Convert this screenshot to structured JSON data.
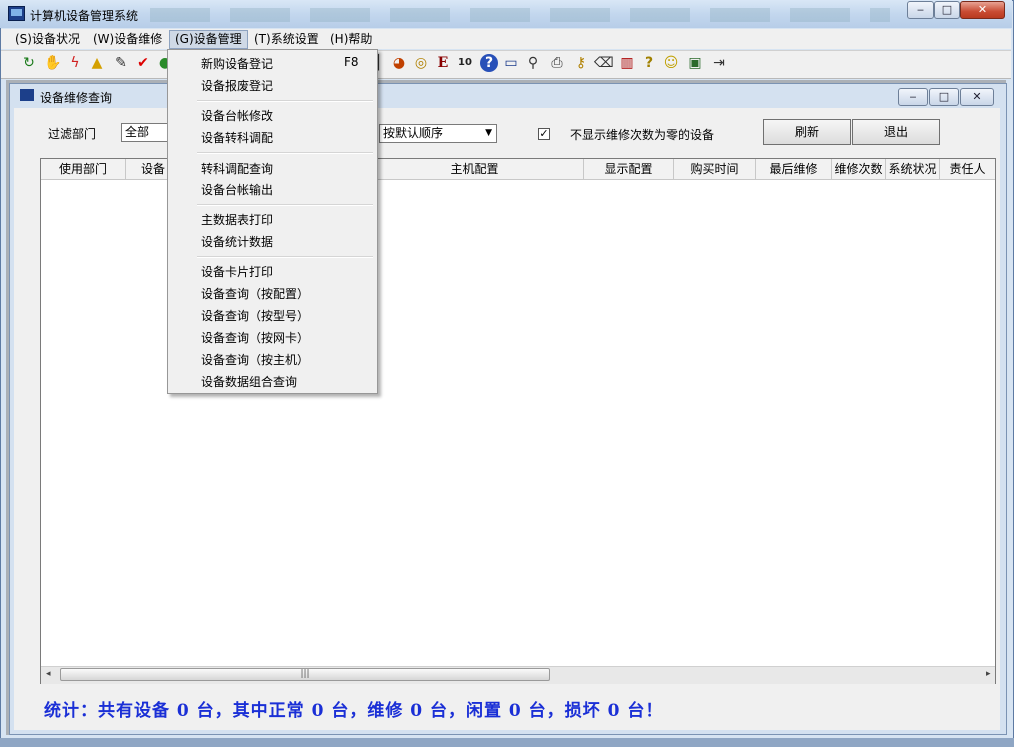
{
  "window": {
    "title": "计算机设备管理系统",
    "min": "‒",
    "max": "□",
    "close": "✕"
  },
  "menubar": [
    "(S)设备状况",
    "(W)设备维修",
    "(G)设备管理",
    "(T)系统设置",
    "(H)帮助"
  ],
  "toolbar_icons": [
    "refresh-icon",
    "stop-hand-icon",
    "lightning-icon",
    "warning-icon",
    "edit-icon",
    "check-icon",
    "tree-icon",
    "book-icon",
    "chart-icon",
    "coins-icon",
    "font-icon",
    "number-icon",
    "help-icon",
    "monitor-icon",
    "filter-icon",
    "printer-icon",
    "key-icon",
    "trash-icon",
    "bar-icon",
    "question-icon",
    "smiley-icon",
    "image-icon",
    "exit-icon"
  ],
  "child": {
    "title": "设备维修查询"
  },
  "filter": {
    "dept_label": "过滤部门",
    "dept_value": "全部",
    "order_value": "按默认顺序",
    "checkbox_checked": "✓",
    "checkbox_label": "不显示维修次数为零的设备",
    "refresh": "刷新",
    "exit": "退出"
  },
  "grid": {
    "columns": [
      "使用部门",
      "设备",
      "",
      "主机配置",
      "显示配置",
      "购买时间",
      "最后维修",
      "维修次数",
      "系统状况",
      "责任人"
    ]
  },
  "scroll": {
    "left": "◂",
    "thumb": "|||",
    "right": "▸"
  },
  "stats": "统计：共有设备 0 台，其中正常 0 台，维修 0 台，闲置 0 台，损坏 0 台！",
  "dropdown": {
    "items": [
      {
        "label": "新购设备登记",
        "shortcut": "F8"
      },
      {
        "label": "设备报废登记"
      },
      {
        "label": "设备台帐修改"
      },
      {
        "label": "设备转科调配"
      },
      {
        "label": "转科调配查询"
      },
      {
        "label": "设备台帐输出"
      },
      {
        "label": "主数据表打印"
      },
      {
        "label": "设备统计数据"
      },
      {
        "label": "设备卡片打印"
      },
      {
        "label": "设备查询（按配置）"
      },
      {
        "label": "设备查询（按型号）"
      },
      {
        "label": "设备查询（按网卡）"
      },
      {
        "label": "设备查询（按主机）"
      },
      {
        "label": "设备数据组合查询"
      }
    ]
  }
}
